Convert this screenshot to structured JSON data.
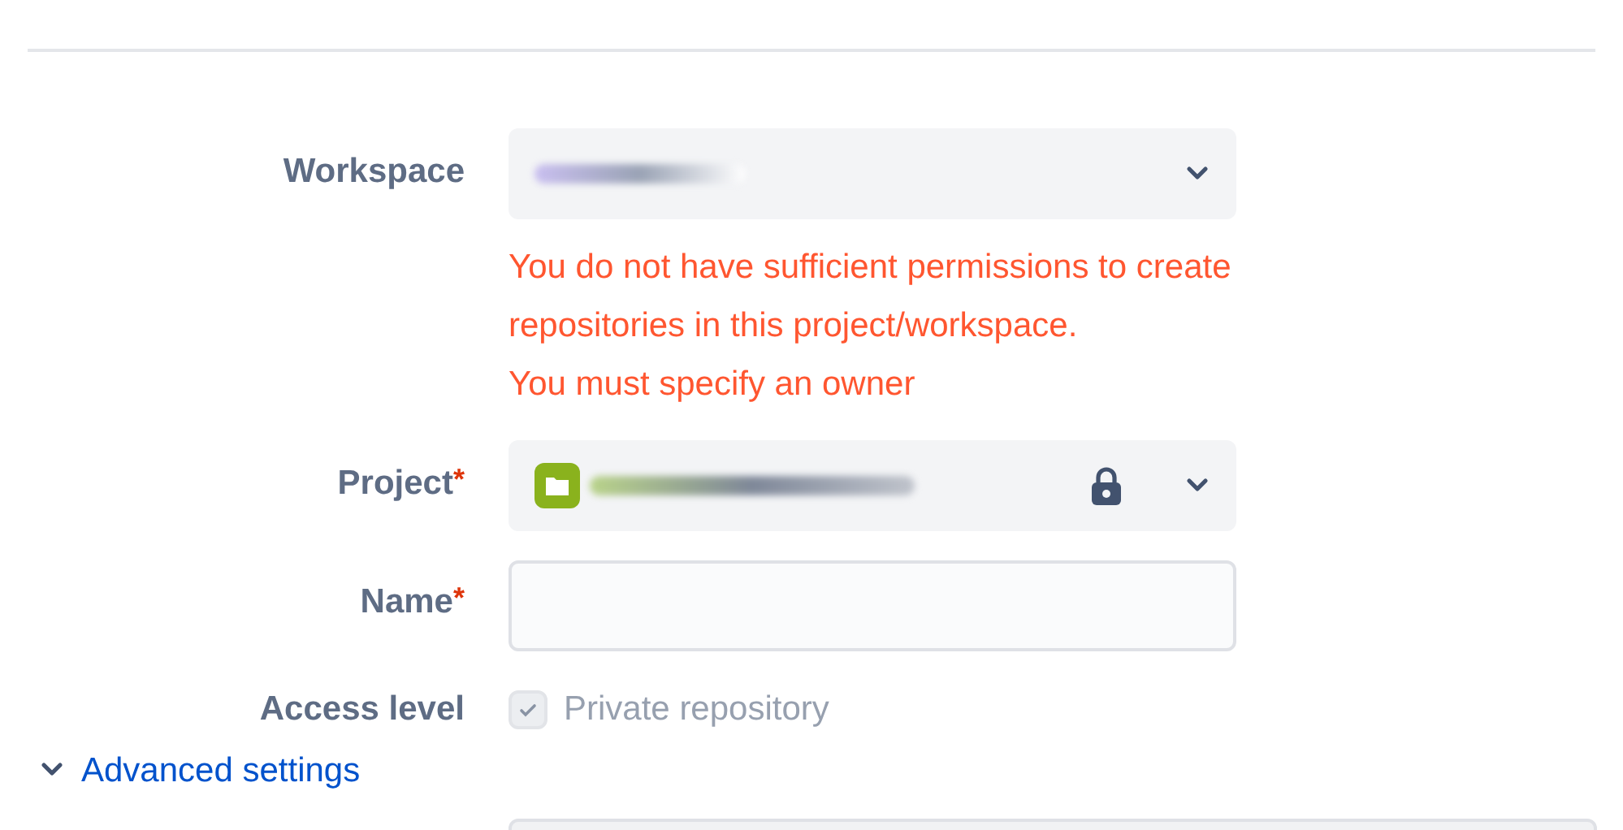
{
  "workspace": {
    "label": "Workspace",
    "errors": [
      "You do not have sufficient permissions to create repositories in this project/workspace.",
      "You must specify an owner"
    ]
  },
  "project": {
    "label": "Project",
    "required_marker": "*",
    "locked": true
  },
  "name": {
    "label": "Name",
    "required_marker": "*"
  },
  "access_level": {
    "label": "Access level",
    "checkbox": {
      "label": "Private repository",
      "checked": true,
      "disabled": true
    }
  },
  "advanced_settings": {
    "label": "Advanced settings",
    "expanded": true
  }
}
